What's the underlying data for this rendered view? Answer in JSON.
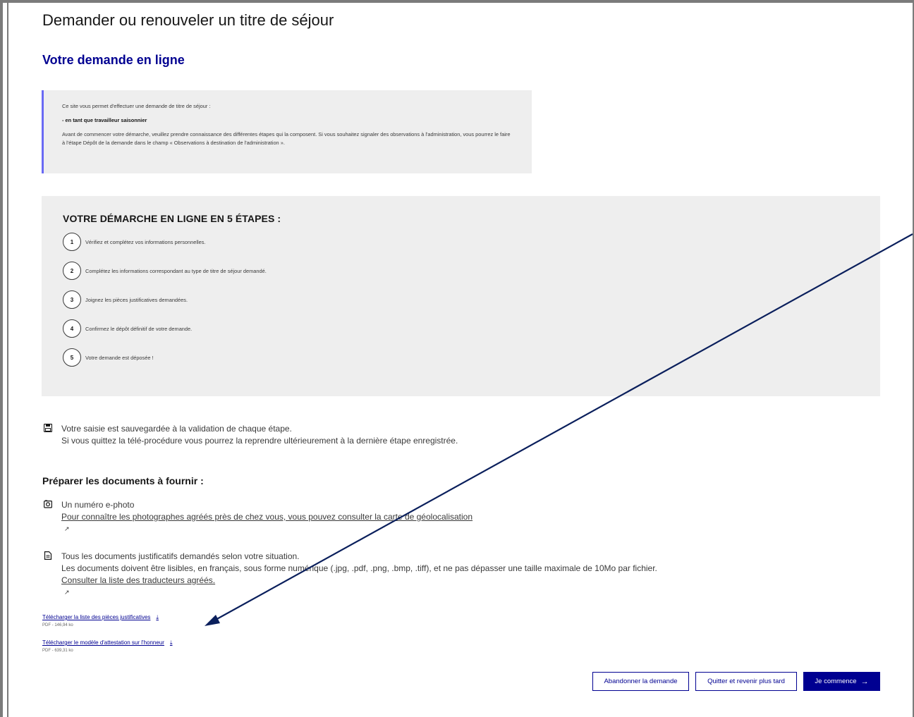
{
  "page": {
    "title": "Demander ou renouveler un titre de séjour",
    "section_title": "Votre demande en ligne"
  },
  "notice": {
    "intro": "Ce site vous permet d'effectuer une demande de titre de séjour :",
    "category": "- en tant que travailleur saisonnier",
    "text": "Avant de commencer votre démarche, veuillez prendre connaissance des différentes étapes qui la composent. Si vous souhaitez signaler des observations à l'administration, vous pourrez le faire à l'étape Dépôt de la demande dans le champ « Observations à destination de l'administration »."
  },
  "steps": {
    "title": "VOTRE DÉMARCHE EN LIGNE EN 5 ÉTAPES :",
    "items": [
      {
        "num": "1",
        "text": "Vérifiez et complétez vos informations personnelles."
      },
      {
        "num": "2",
        "text": "Complétez les informations correspondant au type de titre de séjour demandé."
      },
      {
        "num": "3",
        "text": "Joignez les pièces justificatives demandées."
      },
      {
        "num": "4",
        "text": "Confirmez le dépôt définitif de votre demande."
      },
      {
        "num": "5",
        "text": "Votre demande est déposée !"
      }
    ]
  },
  "save_info": {
    "icon": "save-icon",
    "line1": "Votre saisie est sauvegardée à la validation de chaque étape.",
    "line2": "Si vous quittez la télé-procédure vous pourrez la reprendre ultérieurement à la dernière étape enregistrée."
  },
  "documents": {
    "title": "Préparer les documents à fournir :",
    "photo": {
      "icon": "camera-icon",
      "label": "Un numéro e-photo",
      "link": "Pour connaître les photographes agréés près de chez vous, vous pouvez consulter la carte de géolocalisation"
    },
    "justificatifs": {
      "icon": "document-icon",
      "line1": "Tous les documents justificatifs demandés selon votre situation.",
      "line2": "Les documents doivent être lisibles, en français, sous forme numérique (.jpg, .pdf, .png, .bmp, .tiff), et ne pas dépasser une taille maximale de 10Mo par fichier.",
      "link": "Consulter la liste des traducteurs agréés."
    }
  },
  "downloads": [
    {
      "label": "Télécharger la liste des pièces justificatives",
      "meta": "PDF - 146,94 ko"
    },
    {
      "label": "Télécharger le modèle d'attestation sur l'honneur",
      "meta": "PDF - 639,31 ko"
    }
  ],
  "buttons": {
    "abandon": "Abandonner la demande",
    "later": "Quitter et revenir plus tard",
    "start": "Je commence"
  },
  "colors": {
    "primary": "#000091",
    "notice_border": "#6a6af4",
    "panel_bg": "#eeeeee",
    "annotation_arrow": "#0a1f5c"
  }
}
